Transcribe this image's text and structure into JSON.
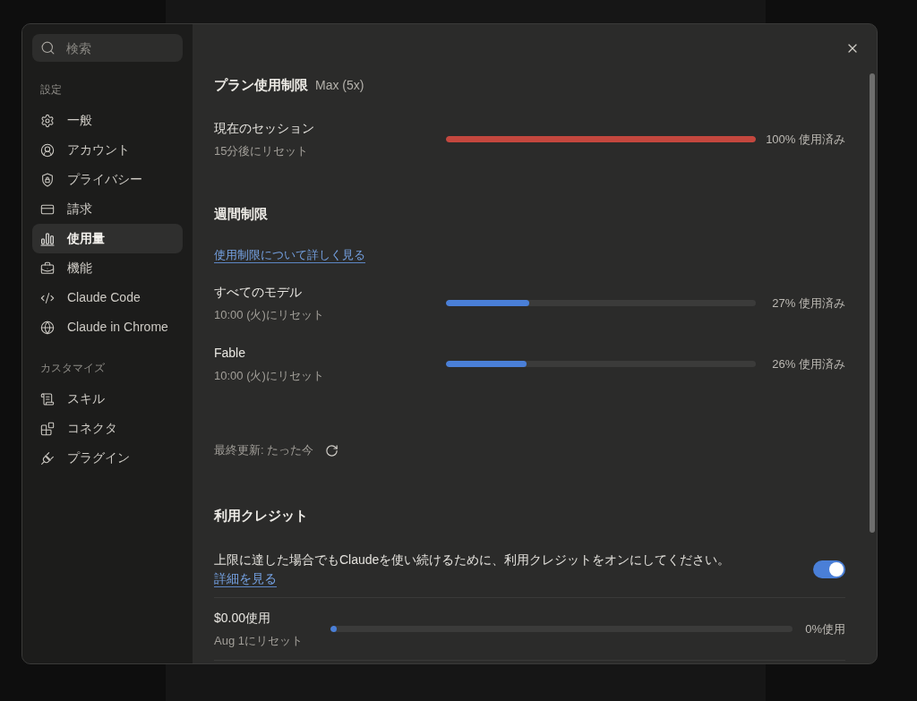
{
  "sidebar": {
    "search": {
      "placeholder": "検索"
    },
    "sections": [
      {
        "heading": "設定",
        "items": [
          {
            "label": "一般",
            "selected": false
          },
          {
            "label": "アカウント",
            "selected": false
          },
          {
            "label": "プライバシー",
            "selected": false
          },
          {
            "label": "請求",
            "selected": false
          },
          {
            "label": "使用量",
            "selected": true
          },
          {
            "label": "機能",
            "selected": false
          },
          {
            "label": "Claude Code",
            "selected": false
          },
          {
            "label": "Claude in Chrome",
            "selected": false
          }
        ]
      },
      {
        "heading": "カスタマイズ",
        "items": [
          {
            "label": "スキル",
            "selected": false
          },
          {
            "label": "コネクタ",
            "selected": false
          },
          {
            "label": "プラグイン",
            "selected": false
          }
        ]
      }
    ]
  },
  "plan_limits": {
    "title": "プラン使用制限",
    "plan": "Max (5x)",
    "meters": [
      {
        "label": "現在のセッション",
        "reset": "15分後にリセット",
        "level": 1.0,
        "reading": "100% 使用済み"
      }
    ]
  },
  "weekly_limits": {
    "title": "週間制限",
    "link": "使用制限について詳しく見る",
    "meters": [
      {
        "label": "すべてのモデル",
        "reset": "10:00 (火)にリセット",
        "level": 0.27,
        "reading": "27% 使用済み"
      },
      {
        "label": "Fable",
        "reset": "10:00 (火)にリセット",
        "level": 0.26,
        "reading": "26% 使用済み"
      }
    ],
    "last_updated": "最終更新: たった今"
  },
  "extra_usage": {
    "title": "利用クレジット",
    "description": "上限に達した場合でもClaudeを使い続けるために、利用クレジットをオンにしてください。",
    "link": "詳細を見る",
    "toggle": {
      "on": true
    },
    "meter": {
      "label": "$0.00使用",
      "reset": "Aug 1にリセット",
      "level": 0,
      "reading": "0%使用"
    }
  }
}
